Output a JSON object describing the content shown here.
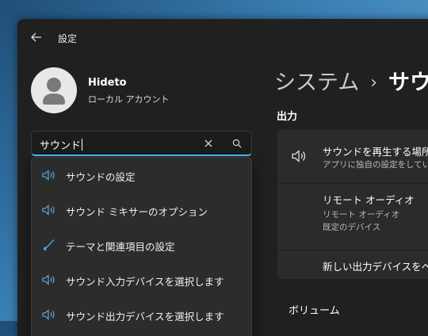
{
  "window": {
    "title": "設定"
  },
  "user": {
    "name": "Hideto",
    "account_type": "ローカル アカウント"
  },
  "search": {
    "value": "サウンド"
  },
  "suggestions": [
    {
      "icon": "speaker-icon",
      "label": "サウンドの設定"
    },
    {
      "icon": "speaker-icon",
      "label": "サウンド ミキサーのオプション"
    },
    {
      "icon": "brush-icon",
      "label": "テーマと関連項目の設定"
    },
    {
      "icon": "speaker-icon",
      "label": "サウンド入力デバイスを選択します"
    },
    {
      "icon": "speaker-icon",
      "label": "サウンド出力デバイスを選択します"
    }
  ],
  "breadcrumb": {
    "parent": "システム",
    "separator": "›",
    "current": "サウン"
  },
  "output": {
    "heading": "出力",
    "rows": [
      {
        "title": "サウンドを再生する場所",
        "subtitle": "アプリに独自の設定をしてい"
      },
      {
        "title": "リモート オーディオ",
        "subtitle1": "リモート オーディオ",
        "subtitle2": "既定のデバイス"
      },
      {
        "title": "新しい出力デバイスをペア"
      }
    ]
  },
  "volume": {
    "heading": "ボリューム"
  },
  "colors": {
    "accent": "#4cc2ff",
    "window_bg": "#202020",
    "card_bg": "#2b2b2b"
  }
}
